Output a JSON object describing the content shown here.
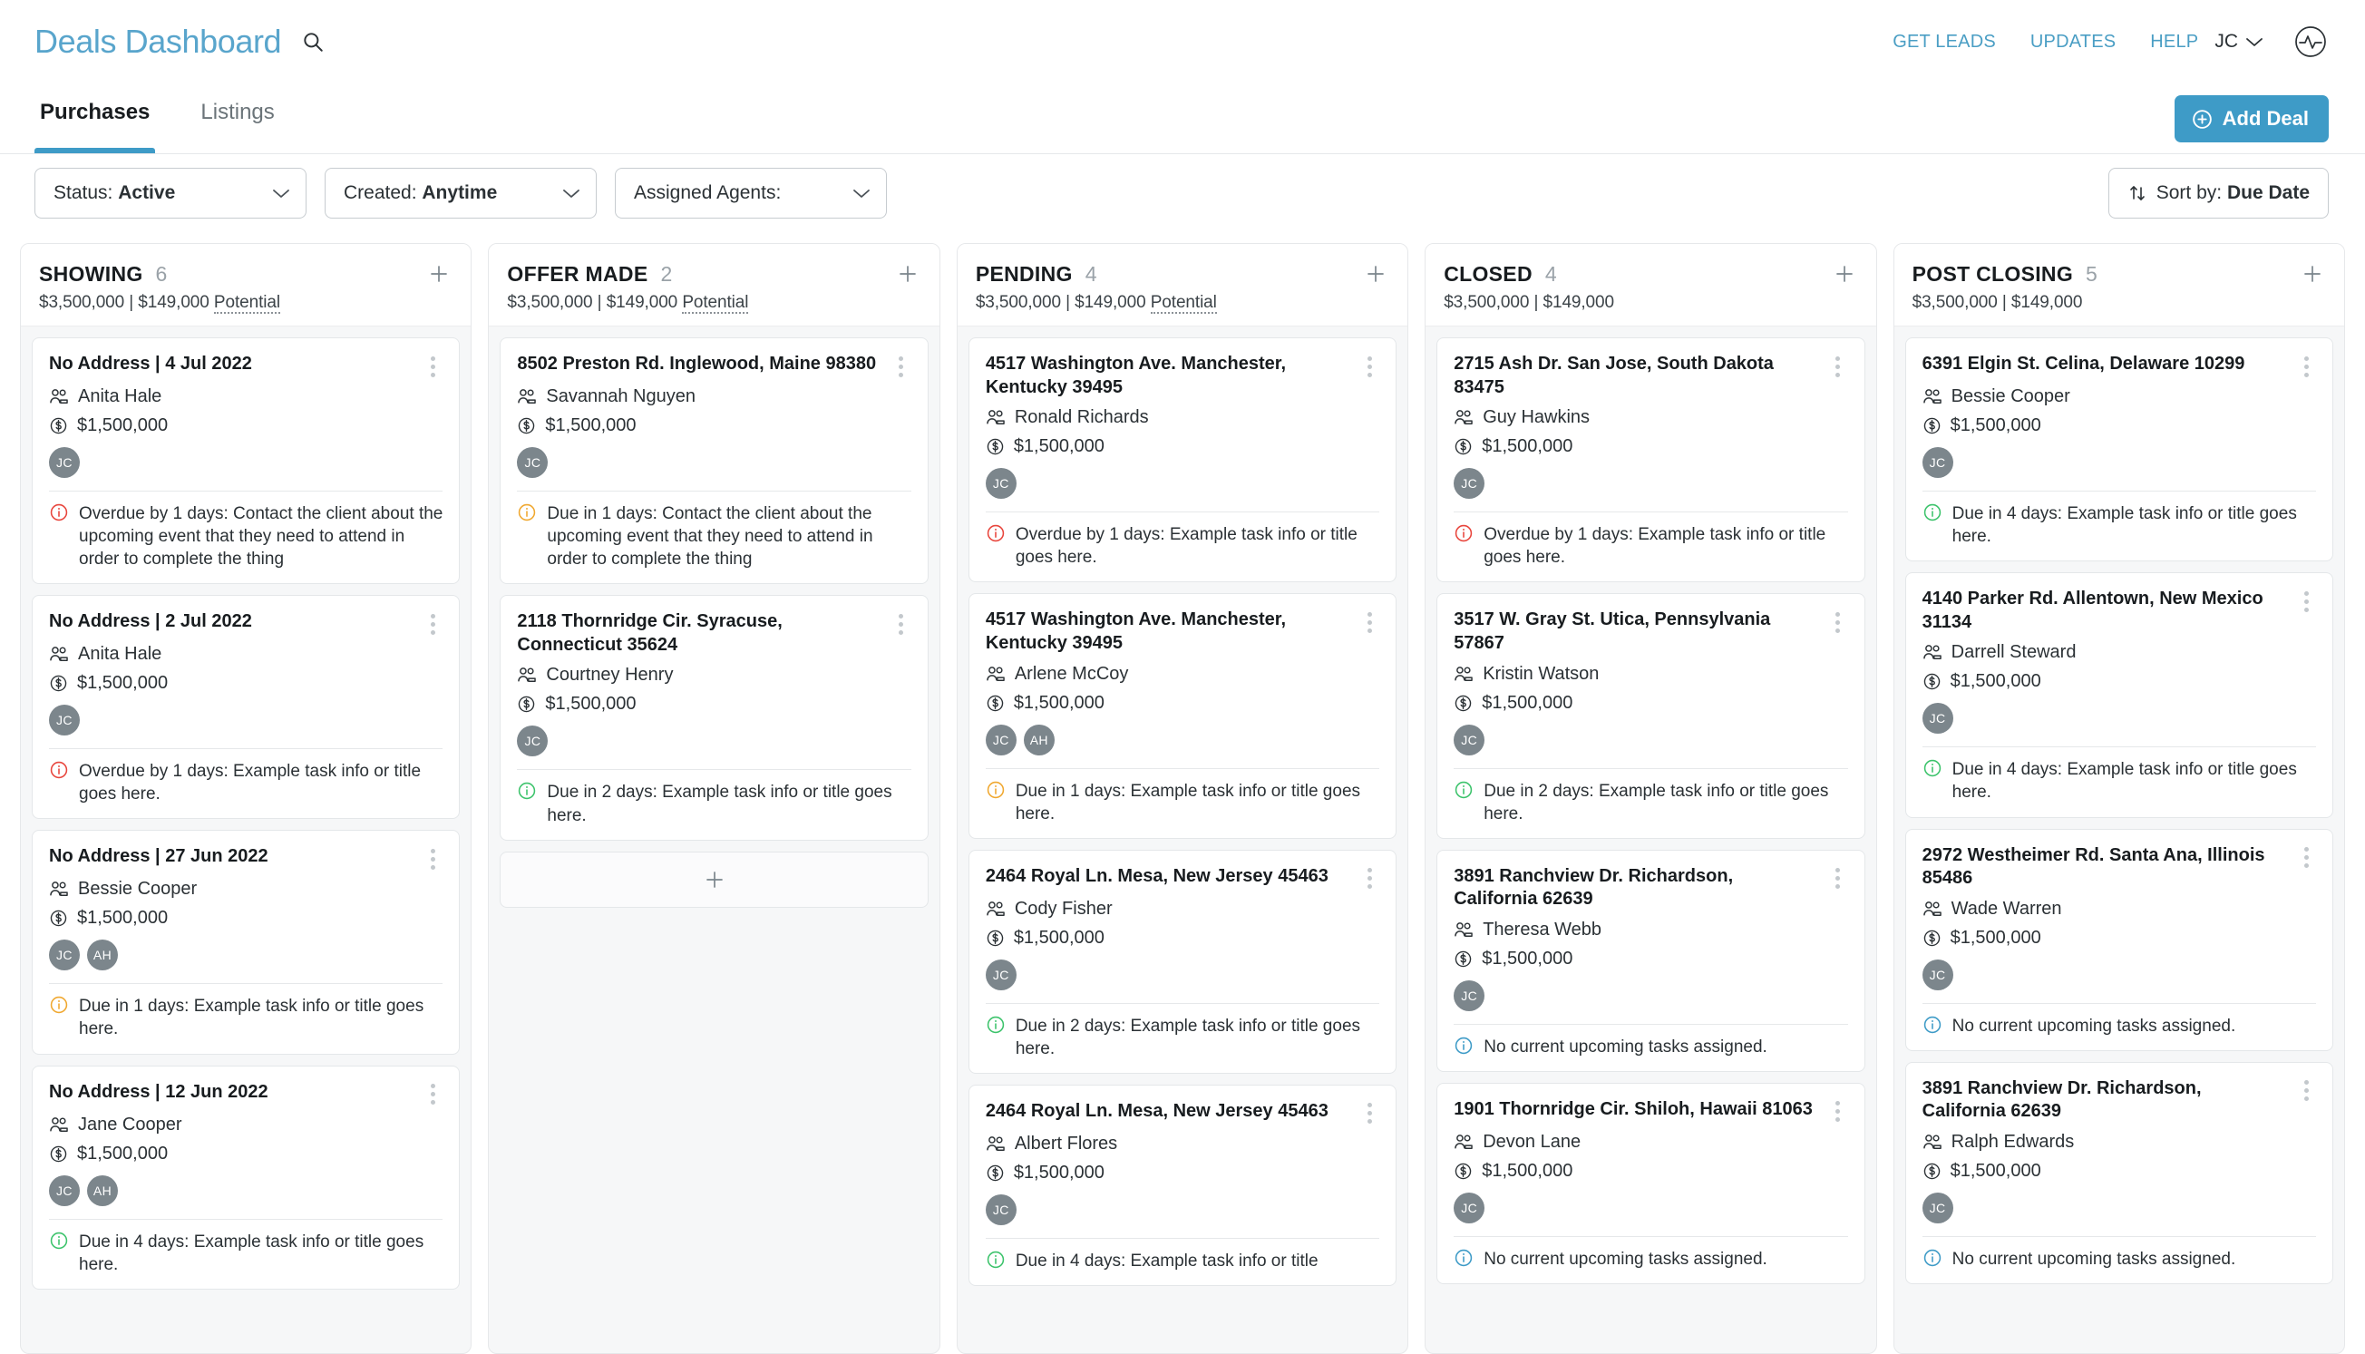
{
  "header": {
    "brand": "Deals Dashboard",
    "search_icon": "search-icon",
    "nav": [
      {
        "label": "GET LEADS"
      },
      {
        "label": "UPDATES"
      },
      {
        "label": "HELP"
      }
    ],
    "user_initials": "JC",
    "logo_icon": "pulse-logo-icon"
  },
  "tabs": [
    {
      "label": "Purchases",
      "active": true
    },
    {
      "label": "Listings",
      "active": false
    }
  ],
  "add_deal_label": "Add Deal",
  "filters": [
    {
      "label": "Status:",
      "value": "Active",
      "name": "status-filter"
    },
    {
      "label": "Created:",
      "value": "Anytime",
      "name": "created-filter"
    },
    {
      "label": "Assigned Agents:",
      "value": "",
      "name": "assigned-agents-filter"
    }
  ],
  "sort": {
    "label": "Sort by:",
    "value": "Due Date"
  },
  "colors": {
    "accent": "#3e9bc7",
    "brand_text": "#59a5cc",
    "overdue": "#e8453c",
    "due_soon": "#f0a830",
    "due_later": "#3cc36b",
    "info": "#3e9bc7",
    "avatar_bg": "#7c868c"
  },
  "columns": [
    {
      "name": "showing",
      "title": "SHOWING",
      "count": "6",
      "subtitle_amount": "$3,500,000 | $149,000 ",
      "subtitle_suffix": "Potential",
      "has_potential": true,
      "add_placeholder": false,
      "cards": [
        {
          "title": "No Address | 4 Jul 2022",
          "client": "Anita Hale",
          "amount": "$1,500,000",
          "avatars": [
            "JC"
          ],
          "task": "Overdue by 1 days: Contact the client about the upcoming event that they need to attend in order to complete the thing",
          "task_state": "overdue"
        },
        {
          "title": "No Address | 2 Jul 2022",
          "client": "Anita Hale",
          "amount": "$1,500,000",
          "avatars": [
            "JC"
          ],
          "task": "Overdue by 1 days: Example task info or title goes here.",
          "task_state": "overdue"
        },
        {
          "title": "No Address | 27 Jun 2022",
          "client": "Bessie Cooper",
          "amount": "$1,500,000",
          "avatars": [
            "JC",
            "AH"
          ],
          "task": "Due in 1 days: Example task info or title goes here.",
          "task_state": "due_soon"
        },
        {
          "title": "No Address | 12 Jun 2022",
          "client": "Jane Cooper",
          "amount": "$1,500,000",
          "avatars": [
            "JC",
            "AH"
          ],
          "task": "Due in 4 days: Example task info or title goes here.",
          "task_state": "due_later"
        }
      ]
    },
    {
      "name": "offer-made",
      "title": "OFFER MADE",
      "count": "2",
      "subtitle_amount": "$3,500,000 | $149,000 ",
      "subtitle_suffix": "Potential",
      "has_potential": true,
      "add_placeholder": true,
      "cards": [
        {
          "title": "8502 Preston Rd. Inglewood, Maine 98380",
          "client": "Savannah Nguyen",
          "amount": "$1,500,000",
          "avatars": [
            "JC"
          ],
          "task": "Due in 1 days: Contact the client about the upcoming event that they need to attend in order to complete the thing",
          "task_state": "due_soon"
        },
        {
          "title": "2118 Thornridge Cir. Syracuse, Connecticut 35624",
          "client": "Courtney Henry",
          "amount": "$1,500,000",
          "avatars": [
            "JC"
          ],
          "task": "Due in 2 days: Example task info or title goes here.",
          "task_state": "due_later"
        }
      ]
    },
    {
      "name": "pending",
      "title": "PENDING",
      "count": "4",
      "subtitle_amount": "$3,500,000 | $149,000 ",
      "subtitle_suffix": "Potential",
      "has_potential": true,
      "add_placeholder": false,
      "cards": [
        {
          "title": "4517 Washington Ave. Manchester, Kentucky 39495",
          "client": "Ronald Richards",
          "amount": "$1,500,000",
          "avatars": [
            "JC"
          ],
          "task": "Overdue by 1 days: Example task info or title goes here.",
          "task_state": "overdue"
        },
        {
          "title": "4517 Washington Ave. Manchester, Kentucky 39495",
          "client": "Arlene McCoy",
          "amount": "$1,500,000",
          "avatars": [
            "JC",
            "AH"
          ],
          "task": "Due in 1 days: Example task info or title goes here.",
          "task_state": "due_soon"
        },
        {
          "title": "2464 Royal Ln. Mesa, New Jersey 45463",
          "client": "Cody Fisher",
          "amount": "$1,500,000",
          "avatars": [
            "JC"
          ],
          "task": "Due in 2 days: Example task info or title goes here.",
          "task_state": "due_later"
        },
        {
          "title": "2464 Royal Ln. Mesa, New Jersey 45463",
          "client": "Albert Flores",
          "amount": "$1,500,000",
          "avatars": [
            "JC"
          ],
          "task": "Due in 4 days: Example task info or title",
          "task_state": "due_later"
        }
      ]
    },
    {
      "name": "closed",
      "title": "CLOSED",
      "count": "4",
      "subtitle_amount": "$3,500,000 | $149,000",
      "subtitle_suffix": "",
      "has_potential": false,
      "add_placeholder": false,
      "cards": [
        {
          "title": "2715 Ash Dr. San Jose, South Dakota 83475",
          "client": "Guy Hawkins",
          "amount": "$1,500,000",
          "avatars": [
            "JC"
          ],
          "task": "Overdue by 1 days: Example task info or title goes here.",
          "task_state": "overdue"
        },
        {
          "title": "3517 W. Gray St. Utica, Pennsylvania 57867",
          "client": "Kristin Watson",
          "amount": "$1,500,000",
          "avatars": [
            "JC"
          ],
          "task": "Due in 2 days: Example task info or title goes here.",
          "task_state": "due_later"
        },
        {
          "title": "3891 Ranchview Dr. Richardson, California 62639",
          "client": "Theresa Webb",
          "amount": "$1,500,000",
          "avatars": [
            "JC"
          ],
          "task": "No current upcoming tasks assigned.",
          "task_state": "info"
        },
        {
          "title": "1901 Thornridge Cir. Shiloh, Hawaii 81063",
          "client": "Devon Lane",
          "amount": "$1,500,000",
          "avatars": [
            "JC"
          ],
          "task": "No current upcoming tasks assigned.",
          "task_state": "info"
        }
      ]
    },
    {
      "name": "post-closing",
      "title": "POST CLOSING",
      "count": "5",
      "subtitle_amount": "$3,500,000 | $149,000",
      "subtitle_suffix": "",
      "has_potential": false,
      "add_placeholder": false,
      "cards": [
        {
          "title": "6391 Elgin St. Celina, Delaware 10299",
          "client": "Bessie Cooper",
          "amount": "$1,500,000",
          "avatars": [
            "JC"
          ],
          "task": "Due in 4 days: Example task info or title goes here.",
          "task_state": "due_later"
        },
        {
          "title": "4140 Parker Rd. Allentown, New Mexico 31134",
          "client": "Darrell Steward",
          "amount": "$1,500,000",
          "avatars": [
            "JC"
          ],
          "task": "Due in 4 days: Example task info or title goes here.",
          "task_state": "due_later"
        },
        {
          "title": "2972 Westheimer Rd. Santa Ana, Illinois 85486",
          "client": "Wade Warren",
          "amount": "$1,500,000",
          "avatars": [
            "JC"
          ],
          "task": "No current upcoming tasks assigned.",
          "task_state": "info"
        },
        {
          "title": "3891 Ranchview Dr. Richardson, California 62639",
          "client": "Ralph Edwards",
          "amount": "$1,500,000",
          "avatars": [
            "JC"
          ],
          "task": "No current upcoming tasks assigned.",
          "task_state": "info"
        }
      ]
    }
  ]
}
